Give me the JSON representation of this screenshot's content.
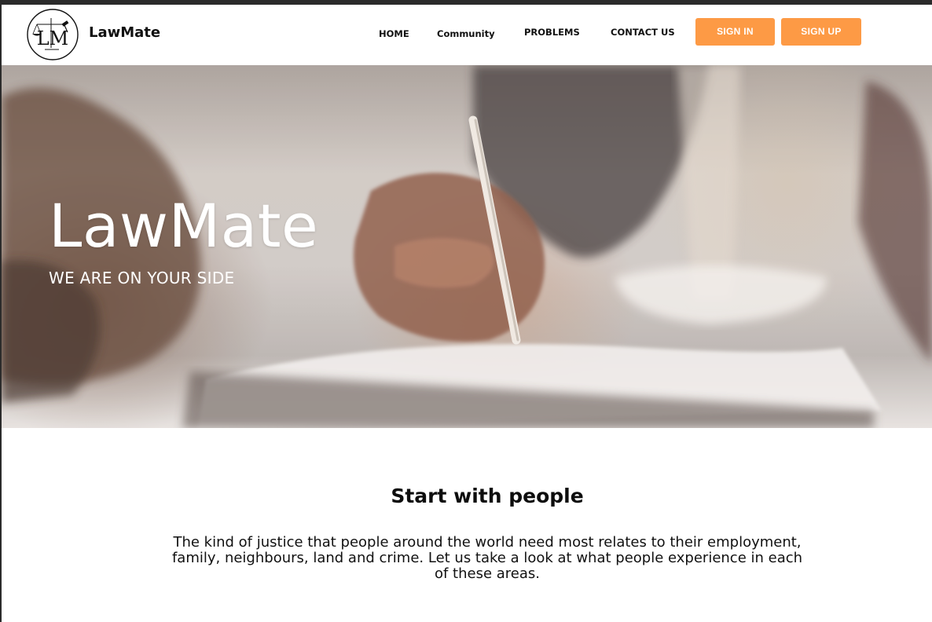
{
  "header": {
    "brand": "LawMate",
    "logo_monogram": "LM",
    "nav": {
      "home": "HOME",
      "community": "Community",
      "problems": "PROBLEMS",
      "contact": "CONTACT US"
    },
    "sign_in": "SIGN IN",
    "sign_up": "SIGN UP"
  },
  "hero": {
    "title": "LawMate",
    "subtitle": "WE ARE ON YOUR SIDE"
  },
  "intro": {
    "title": "Start with people",
    "text": "The kind of justice that people around the world need most relates to their employment, family, neighbours, land and crime. Let us take a look at what people experience in each of these areas."
  },
  "colors": {
    "accent": "#fd9a45",
    "text": "#111111",
    "background": "#ffffff"
  },
  "icons": {
    "logo": "scales-of-justice-icon"
  }
}
